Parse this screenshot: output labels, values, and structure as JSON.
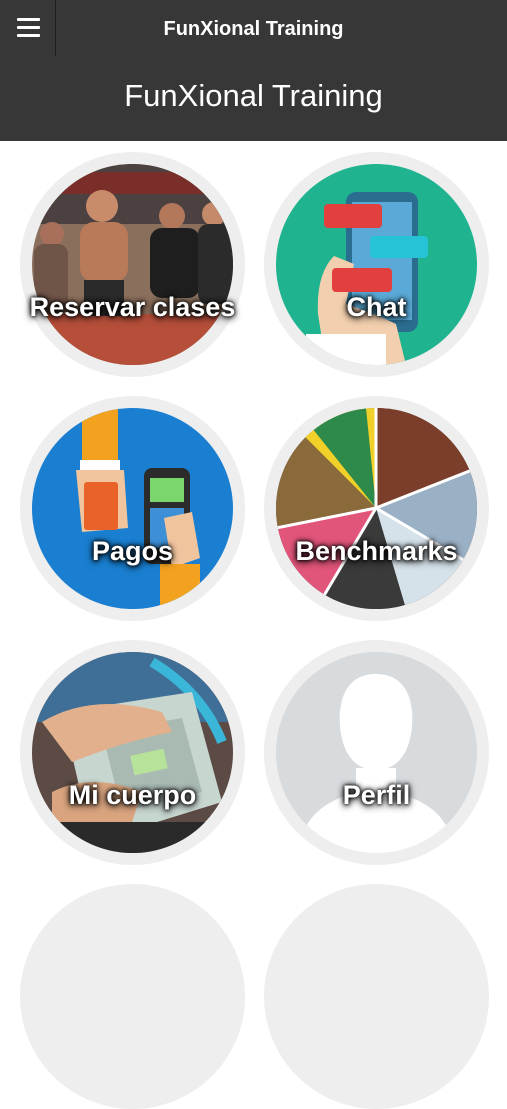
{
  "app": {
    "title": "FunXional Training"
  },
  "header": {
    "title": "FunXional Training"
  },
  "tiles": [
    {
      "label": "Reservar clases",
      "icon": "athletes-running-photo-icon"
    },
    {
      "label": "Chat",
      "icon": "chat-phone-icon"
    },
    {
      "label": "Pagos",
      "icon": "card-payment-terminal-icon"
    },
    {
      "label": "Benchmarks",
      "icon": "sports-collage-icon"
    },
    {
      "label": "Mi cuerpo",
      "icon": "bathroom-scale-icon"
    },
    {
      "label": "Perfil",
      "icon": "user-silhouette-icon"
    }
  ],
  "colors": {
    "topbar": "#373737",
    "tile_ring": "#eeeeee",
    "chat_bg": "#1fb48f",
    "pagos_bg": "#1a7fd0",
    "perfil_bg": "#d7dbde"
  }
}
